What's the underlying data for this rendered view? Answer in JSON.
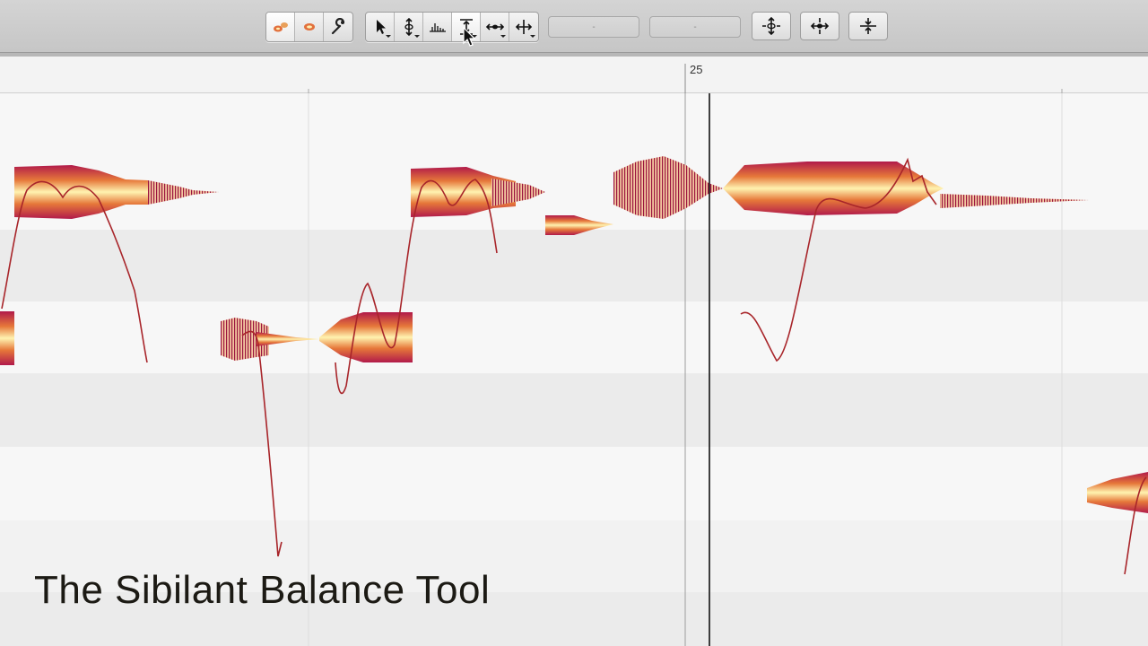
{
  "toolbar": {
    "groups": [
      {
        "buttons": [
          {
            "name": "main-tool-icon",
            "active": true
          },
          {
            "name": "blob-tool-icon",
            "active": false
          },
          {
            "name": "wrench-icon",
            "active": false
          }
        ]
      },
      {
        "buttons": [
          {
            "name": "pointer-tool-icon",
            "menu": true
          },
          {
            "name": "pitch-tool-icon",
            "menu": true
          },
          {
            "name": "sibilant-balance-icon",
            "menu": false
          },
          {
            "name": "amplitude-tool-icon",
            "menu": true,
            "active": true
          },
          {
            "name": "time-tool-icon",
            "menu": true
          },
          {
            "name": "separation-tool-icon",
            "menu": true
          }
        ]
      }
    ],
    "field1": "-",
    "field2": "-"
  },
  "ruler": {
    "bar_number": "25"
  },
  "caption": "The Sibilant Balance Tool",
  "colors": {
    "note_outer": "#b11a4a",
    "note_mid": "#e6783a",
    "note_inner": "#fff3b0",
    "pitch_curve": "#a8252a"
  }
}
